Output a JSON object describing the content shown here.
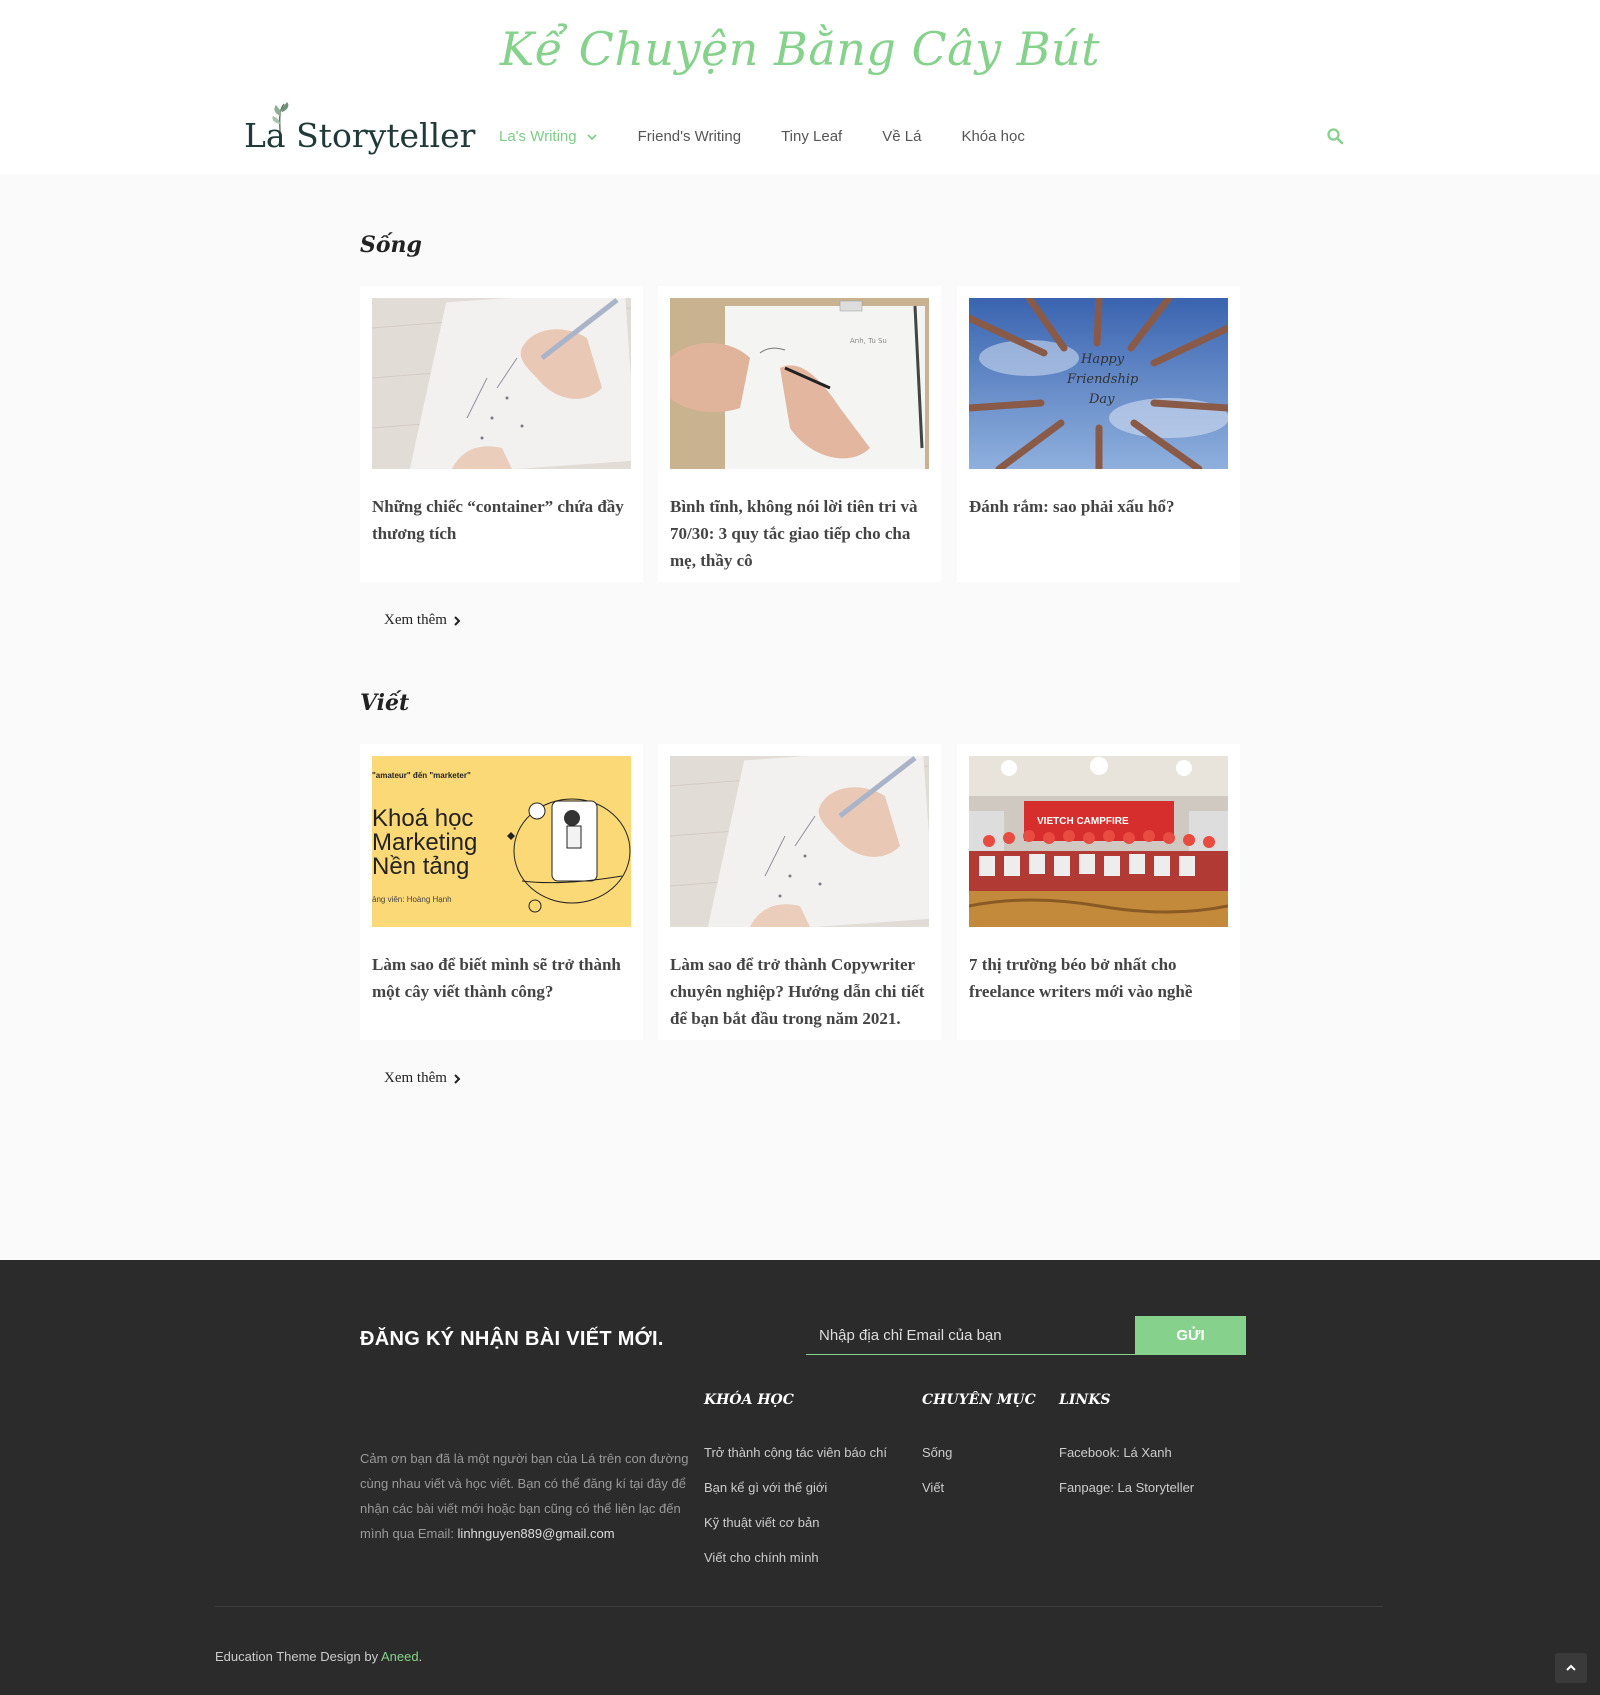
{
  "header": {
    "tagline": "Kể Chuyện Bằng Cây Bút",
    "logo_text": "La Storyteller",
    "nav": [
      {
        "label": "La's Writing",
        "active": true
      },
      {
        "label": "Friend's Writing"
      },
      {
        "label": "Tiny Leaf"
      },
      {
        "label": "Về Lá"
      },
      {
        "label": "Khóa học"
      }
    ]
  },
  "sections": [
    {
      "title": "Sống",
      "more_label": "Xem thêm",
      "posts": [
        {
          "title": "Những chiếc “container” chứa đầy thương tích",
          "image": "hand-writing-notes"
        },
        {
          "title": "Bình tĩnh, không nói lời tiên tri và 70/30: 3 quy tắc giao tiếp cho cha mẹ, thầy cô",
          "image": "hand-writing-paper"
        },
        {
          "title": "Đánh rắm: sao phải xấu hổ?",
          "image": "friendship-hands"
        }
      ]
    },
    {
      "title": "Viết",
      "more_label": "Xem thêm",
      "posts": [
        {
          "title": "Làm sao để biết mình sẽ trở thành một cây viết thành công?",
          "image": "course-banner"
        },
        {
          "title": "Làm sao để trở thành Copywriter chuyên nghiệp? Hướng dẫn chi tiết để bạn bắt đầu trong năm 2021.",
          "image": "hand-writing-notes"
        },
        {
          "title": "7 thị trường béo bở nhất cho freelance writers mới vào nghề",
          "image": "group-photo"
        }
      ]
    }
  ],
  "images": {
    "friendship_text": [
      "Happy",
      "Friendship",
      "Day"
    ],
    "course_banner": {
      "tagline": "\"amateur\" đến \"marketer\"",
      "lines": [
        "Khoá học",
        "Marketing",
        "Nền tảng"
      ],
      "instructor": "ảng viên: Hoàng Hạnh"
    },
    "paper_label": "Anh, Tu Su",
    "event_banner": "VIETCH CAMPFIRE"
  },
  "footer": {
    "subscribe_title": "ĐĂNG KÝ NHẬN BÀI VIẾT MỚI.",
    "email_placeholder": "Nhập địa chỉ Email của bạn",
    "send_label": "GỬI",
    "about_text": "Cảm ơn bạn đã là một người bạn của Lá trên con đường cùng nhau viết và học viết. Bạn có thể đăng kí tại đây để nhận các bài viết mới hoặc bạn cũng có thể liên lạc đến mình qua Email: ",
    "about_email": "linhnguyen889@gmail.com",
    "columns": [
      {
        "title": "KHÓA HỌC",
        "links": [
          "Trở thành cộng tác viên báo chí",
          "Bạn kể gì với thế giới",
          "Kỹ thuật viết cơ bản",
          "Viết cho chính mình"
        ]
      },
      {
        "title": "CHUYÊN MỤC",
        "links": [
          "Sống",
          "Viết"
        ]
      },
      {
        "title": "LINKS",
        "links": [
          "Facebook: Lá Xanh",
          "Fanpage: La Storyteller"
        ]
      }
    ],
    "credit_prefix": "Education Theme Design by ",
    "credit_link": "Aneed",
    "credit_suffix": "."
  },
  "colors": {
    "accent": "#86d28c",
    "footer_bg": "#2b2b2b",
    "page_bg": "#fafafa"
  },
  "icons": {
    "search": "search-icon",
    "caret": "chevron-down-icon",
    "more": "chevron-right-icon",
    "to_top": "chevron-up-icon"
  }
}
